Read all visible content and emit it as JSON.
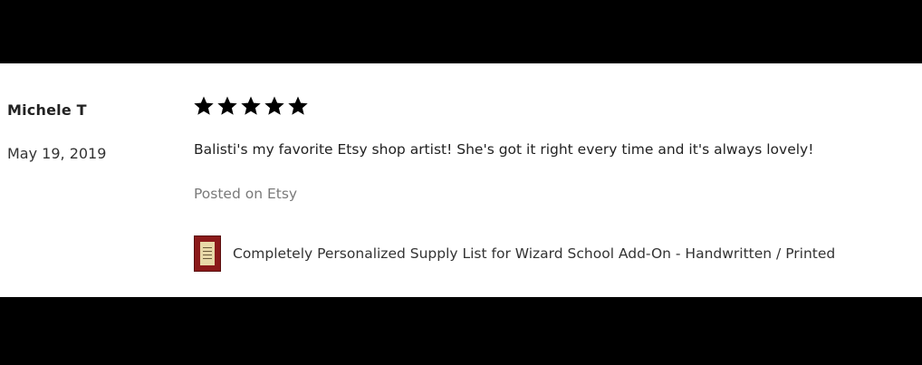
{
  "review": {
    "reviewer_name": "Michele T",
    "date": "May 19, 2019",
    "rating": 5,
    "rating_max": 5,
    "text": "Balisti's my favorite Etsy shop artist! She's got it right every time and it's always lovely!",
    "posted_on": "Posted on Etsy",
    "product": {
      "title": "Completely Personalized Supply List for Wizard School Add-On - Handwritten / Printed",
      "thumbnail_icon": "product-thumbnail-image"
    }
  },
  "colors": {
    "background_bars": "#000000",
    "card_background": "#ffffff",
    "star_fill": "#000000",
    "muted_text": "#7a7a7a"
  }
}
